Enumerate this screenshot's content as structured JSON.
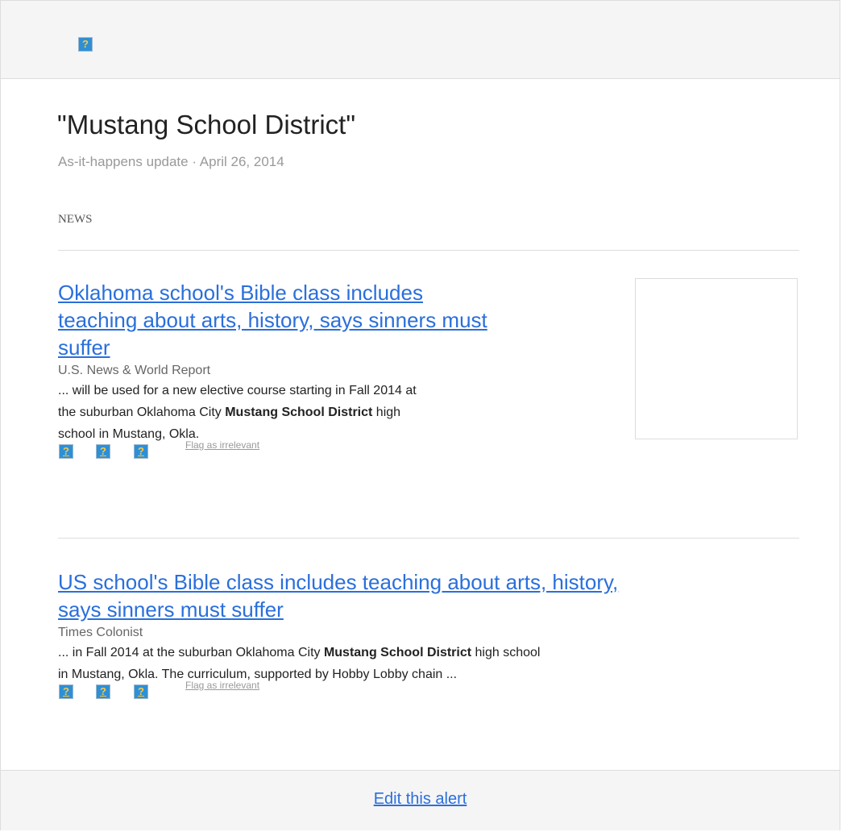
{
  "header": {
    "logo_icon": "question-icon"
  },
  "alert": {
    "title": "\"Mustang School District\"",
    "subtitle": "As-it-happens update · April 26, 2014",
    "section_label": "NEWS"
  },
  "articles": [
    {
      "title_lines": [
        "Oklahoma school's Bible class includes",
        "teaching about arts, history, says sinners must",
        "suffer"
      ],
      "source": "U.S. News & World Report",
      "snippet_line1": "... will be used for a new elective course starting in Fall 2014 at",
      "snippet_line2_pre": "the suburban Oklahoma City ",
      "snippet_bold": "Mustang School District",
      "snippet_line2_post": " high",
      "snippet_line3": "school in Mustang, Okla.",
      "flag_label": "Flag as irrelevant"
    },
    {
      "title_lines": [
        "US school's Bible class includes teaching about arts, history,",
        "says sinners must suffer"
      ],
      "source": "Times Colonist",
      "snippet_line1_pre": "... in Fall 2014 at the suburban Oklahoma City ",
      "snippet_bold": "Mustang School District",
      "snippet_line1_post": " high school",
      "snippet_line2": "in Mustang, Okla. The curriculum, supported by Hobby Lobby chain ...",
      "flag_label": "Flag as irrelevant"
    }
  ],
  "footer": {
    "edit_label": "Edit this alert"
  },
  "colors": {
    "link": "#2a6fdb",
    "muted": "#999999",
    "bar_bg": "#f5f5f5",
    "icon_bg": "#2f8fd5"
  }
}
